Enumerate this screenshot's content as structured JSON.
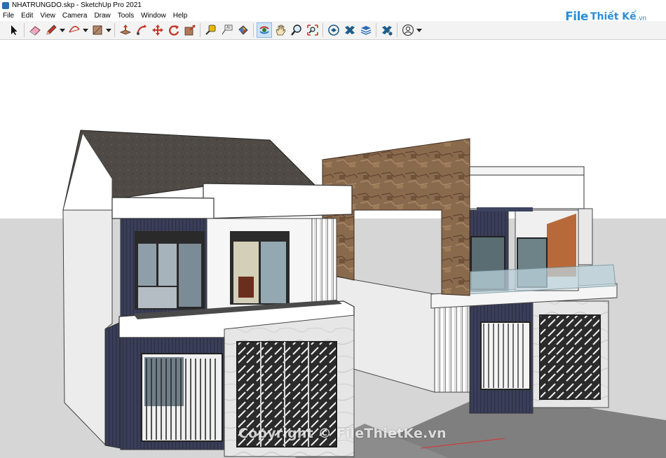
{
  "window": {
    "title": "NHATRUNGDO.skp - SketchUp Pro 2021"
  },
  "menu": [
    "File",
    "Edit",
    "View",
    "Camera",
    "Draw",
    "Tools",
    "Window",
    "Help"
  ],
  "logo": {
    "part1": "File",
    "part2": "Thiết Kế",
    "part3": ".vn"
  },
  "watermark": "Copyright © FileThietKe.vn",
  "toolbar": {
    "tools": [
      "select-tool",
      "eraser-tool",
      "pencil-line-tool",
      "arc-tool",
      "rectangle-tool",
      "push-pull-tool",
      "follow-me-tool",
      "move-tool",
      "rotate-tool",
      "scale-tool",
      "tape-measure-tool",
      "text-tool",
      "paint-bucket-tool",
      "orbit-tool",
      "pan-tool",
      "zoom-tool",
      "zoom-extents-tool",
      "warehouse-tool",
      "extension-tool",
      "layers-tool",
      "sandbox-tool",
      "account-tool"
    ],
    "active": "orbit-tool"
  },
  "colors": {
    "accent": "#2a8fd8",
    "sky": "#ffffff",
    "ground": "#d5d5d5",
    "roof": "#4f4a45",
    "stone": "#8a6a4d",
    "wall_navy": "#363a55",
    "axis_red": "#e03030"
  }
}
